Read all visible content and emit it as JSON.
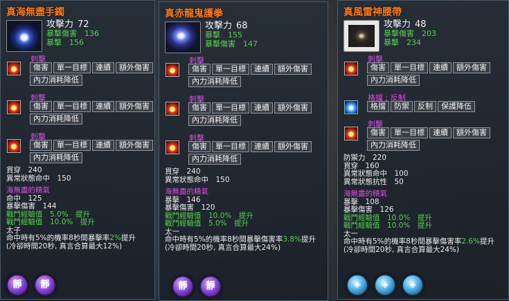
{
  "panels": [
    {
      "title": "真海無盡手鐲",
      "icon": "blue-bracelet-icon",
      "attack_label": "攻擊力",
      "attack_value": "72",
      "stats": [
        {
          "label": "暴擊傷害",
          "value": "136"
        },
        {
          "label": "暴擊",
          "value": "156"
        }
      ],
      "skills": [
        {
          "name": "刺擊",
          "tags": [
            "傷害",
            "單一目標",
            "連續",
            "額外傷害",
            "內力消耗降低"
          ]
        },
        {
          "name": "刺擊",
          "tags": [
            "傷害",
            "單一目標",
            "連續",
            "額外傷害",
            "內力消耗降低"
          ]
        },
        {
          "name": "刺擊",
          "tags": [
            "傷害",
            "單一目標",
            "連續",
            "額外傷害",
            "內力消耗降低"
          ]
        }
      ],
      "base_lines": [
        "貫穿　240",
        "異常狀態命中　150"
      ],
      "essence_title": "海無盡的精氣",
      "essence_lines": [
        "命中　125",
        "暴擊傷害　144"
      ],
      "exp_lines": [
        "戰鬥經驗值　5.0%　提升",
        "戰鬥經驗值　10.0%　提升"
      ],
      "set_name": "太子",
      "effect_text_1": "命中時有5%的機率8秒間暴擊率",
      "effect_highlight": "2%",
      "effect_text_2": "提升",
      "effect_line2": "(冷卻時間20秒, 真言合算最大12%)",
      "badges": [
        "靜",
        "靜"
      ],
      "badge_style": "purple"
    },
    {
      "title": "真赤龍鬼護拳",
      "icon": "blue-gauntlet-icon",
      "attack_label": "攻擊力",
      "attack_value": "68",
      "stats": [
        {
          "label": "暴擊",
          "value": "155"
        },
        {
          "label": "暴擊傷害",
          "value": "147"
        }
      ],
      "skills": [
        {
          "name": "刺擊",
          "tags": [
            "傷害",
            "單一目標",
            "連續",
            "額外傷害",
            "內力消耗降低"
          ]
        },
        {
          "name": "刺擊",
          "tags": [
            "傷害",
            "單一目標",
            "連續",
            "額外傷害",
            "內力消耗降低"
          ]
        },
        {
          "name": "刺擊",
          "tags": [
            "傷害",
            "單一目標",
            "連續",
            "額外傷害",
            "內力消耗降低"
          ]
        }
      ],
      "base_lines": [
        "貫穿　240",
        "異常狀態命中　150"
      ],
      "essence_title": "海無盡的精氣",
      "essence_lines": [
        "暴擊　146",
        "暴擊傷害　120"
      ],
      "exp_lines": [
        "戰鬥經驗值　10.0%　提升",
        "戰鬥經驗值　5.0%　提升"
      ],
      "set_name": "太一",
      "effect_text_1": "命中時有5%的機率8秒間暴擊傷害率",
      "effect_highlight": "3.8%",
      "effect_text_2": "提升",
      "effect_line2": "(冷卻時間20秒, 真言合算最大24%)",
      "badges": [
        "靜",
        "靜"
      ],
      "badge_style": "purple"
    },
    {
      "title": "真風雷神腰帶",
      "icon": "dark-belt-icon",
      "attack_label": "攻擊力",
      "attack_value": "48",
      "stats": [
        {
          "label": "暴擊傷害",
          "value": "203"
        },
        {
          "label": "暴擊",
          "value": "234"
        }
      ],
      "skills": [
        {
          "name": "刺擊",
          "tags": [
            "傷害",
            "單一目標",
            "連續",
            "額外傷害",
            "內力消耗降低"
          ]
        },
        {
          "name": "格擋 ; 反制",
          "tags": [
            "格擋",
            "防禦",
            "反制",
            "保護降伍"
          ]
        },
        {
          "name": "刺擊",
          "tags": [
            "傷害",
            "單一目標",
            "連續",
            "額外傷害",
            "內力消耗降低"
          ]
        }
      ],
      "base_lines": [
        "防禦力　220",
        "貫穿　160",
        "異常狀態命中　100",
        "異常狀態抗性　50"
      ],
      "essence_title": "海無盡的精氣",
      "essence_lines": [
        "暴擊　108",
        "暴擊傷害　126"
      ],
      "exp_lines": [
        "戰鬥經驗值　10.0%　提升",
        "戰鬥經驗值　10.0%　提升"
      ],
      "set_name": "太一",
      "effect_text_1": "命中時有5%的機率8秒間暴擊傷害率",
      "effect_highlight": "2.6%",
      "effect_text_2": "提升",
      "effect_line2": "(冷卻時間20秒, 真言合算最大24%)",
      "badges": [
        "◈",
        "◈",
        "◈"
      ],
      "badge_style": "cyan"
    }
  ]
}
